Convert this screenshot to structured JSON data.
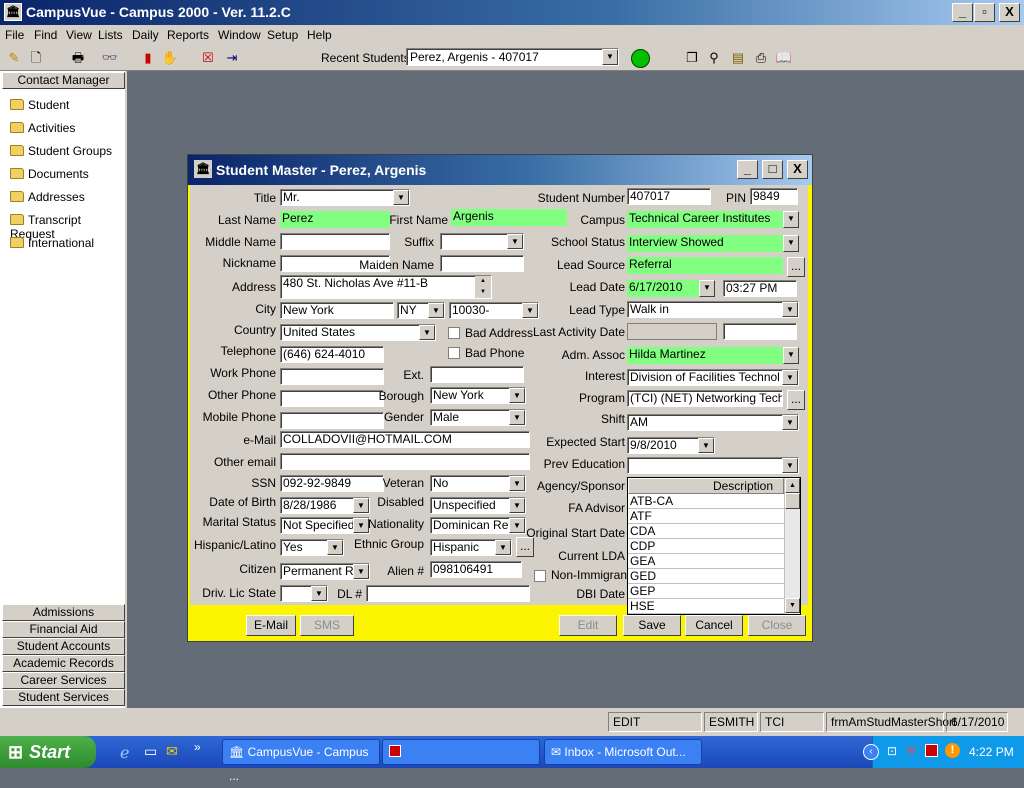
{
  "app": {
    "title": "CampusVue - Campus 2000 - Ver. 11.2.C"
  },
  "window_controls": {
    "minimize": "_",
    "restore": "▫",
    "close": "X"
  },
  "menu": [
    "File",
    "Find",
    "View",
    "Lists",
    "Daily",
    "Reports",
    "Window",
    "Setup",
    "Help"
  ],
  "toolbar": {
    "recent_label": "Recent Students",
    "recent_value": "Perez, Argenis - 407017",
    "status_color": "#00c000"
  },
  "sidebar": {
    "header": "Contact Manager",
    "items": [
      "Student",
      "Activities",
      "Student Groups",
      "Documents",
      "Addresses",
      "Transcript Request",
      "International"
    ],
    "bottom": [
      "Admissions",
      "Financial Aid",
      "Student Accounts",
      "Academic Records",
      "Career Services",
      "Student Services"
    ]
  },
  "dialog": {
    "title": "Student Master - Perez, Argenis",
    "labels": {
      "title": "Title",
      "last_name": "Last Name",
      "first_name": "First Name",
      "middle_name": "Middle Name",
      "suffix": "Suffix",
      "nickname": "Nickname",
      "maiden_name": "Maiden Name",
      "address": "Address",
      "city": "City",
      "country": "Country",
      "telephone": "Telephone",
      "work_phone": "Work Phone",
      "ext": "Ext.",
      "other_phone": "Other Phone",
      "borough": "Borough",
      "mobile_phone": "Mobile Phone",
      "gender": "Gender",
      "email": "e-Mail",
      "other_email": "Other email",
      "ssn": "SSN",
      "veteran": "Veteran",
      "dob": "Date of Birth",
      "disabled": "Disabled",
      "marital": "Marital Status",
      "nationality": "Nationality",
      "hispanic": "Hispanic/Latino",
      "ethnic": "Ethnic Group",
      "citizen": "Citizen",
      "alien": "Alien #",
      "drv_state": "Driv. Lic State",
      "dl": "DL #",
      "bad_address": "Bad Address",
      "bad_phone": "Bad Phone",
      "student_number": "Student Number",
      "pin": "PIN",
      "campus": "Campus",
      "school_status": "School Status",
      "lead_source": "Lead Source",
      "lead_date": "Lead Date",
      "lead_type": "Lead Type",
      "last_activity": "Last Activity Date",
      "adm_assoc": "Adm. Assoc",
      "interest": "Interest",
      "program": "Program",
      "shift": "Shift",
      "expected_start": "Expected Start",
      "prev_education": "Prev Education",
      "agency": "Agency/Sponsor",
      "fa_advisor": "FA Advisor",
      "original_start": "Original Start Date",
      "current_lda": "Current LDA",
      "non_immigrant": "Non-Immigrant S",
      "dbi_date": "DBI Date"
    },
    "values": {
      "title": "Mr.",
      "last_name": "Perez",
      "first_name": "Argenis",
      "middle_name": "",
      "suffix": "",
      "nickname": "",
      "maiden_name": "",
      "address": "480 St. Nicholas Ave #11-B",
      "city": "New York",
      "state": "NY",
      "zip": "10030-",
      "country": "United States",
      "telephone": "(646) 624-4010",
      "work_phone": "",
      "ext": "",
      "other_phone": "",
      "borough": "New York",
      "mobile_phone": "",
      "gender": "Male",
      "email": "COLLADOVII@HOTMAIL.COM",
      "other_email": "",
      "ssn": "092-92-9849",
      "veteran": "No",
      "dob": "8/28/1986",
      "disabled": "Unspecified",
      "marital": "Not Specified",
      "nationality": "Dominican Repu",
      "hispanic": "Yes",
      "ethnic": "Hispanic",
      "citizen": "Permanent Re",
      "alien": "098106491",
      "drv_state": "",
      "dl": "",
      "student_number": "407017",
      "pin": "9849",
      "campus": "Technical Career Institutes",
      "school_status": "Interview Showed",
      "lead_source": "Referral",
      "lead_date": "6/17/2010",
      "lead_time": "03:27 PM",
      "lead_type": "Walk in",
      "last_activity": "",
      "last_activity_2": "",
      "adm_assoc": "Hilda Martinez",
      "interest": "Division of Facilities Technol",
      "program": "(TCI) (NET) Networking Techno",
      "shift": "AM",
      "expected_start": "9/8/2010",
      "prev_education": ""
    },
    "dropdown_list": {
      "header": "Description",
      "items": [
        "ATB-CA",
        "ATF",
        "CDA",
        "CDP",
        "GEA",
        "GED",
        "GEP",
        "HSE"
      ]
    },
    "buttons": {
      "email": "E-Mail",
      "sms": "SMS",
      "edit": "Edit",
      "save": "Save",
      "cancel": "Cancel",
      "close": "Close"
    },
    "ellipsis": "..."
  },
  "statusbar": [
    "EDIT",
    "ESMITH",
    "TCI",
    "frmAmStudMasterShort",
    "6/17/2010"
  ],
  "taskbar": {
    "start": "Start",
    "tasks": [
      "CampusVue - Campus ...",
      "",
      "Inbox - Microsoft Out..."
    ],
    "clock": "4:22 PM"
  }
}
